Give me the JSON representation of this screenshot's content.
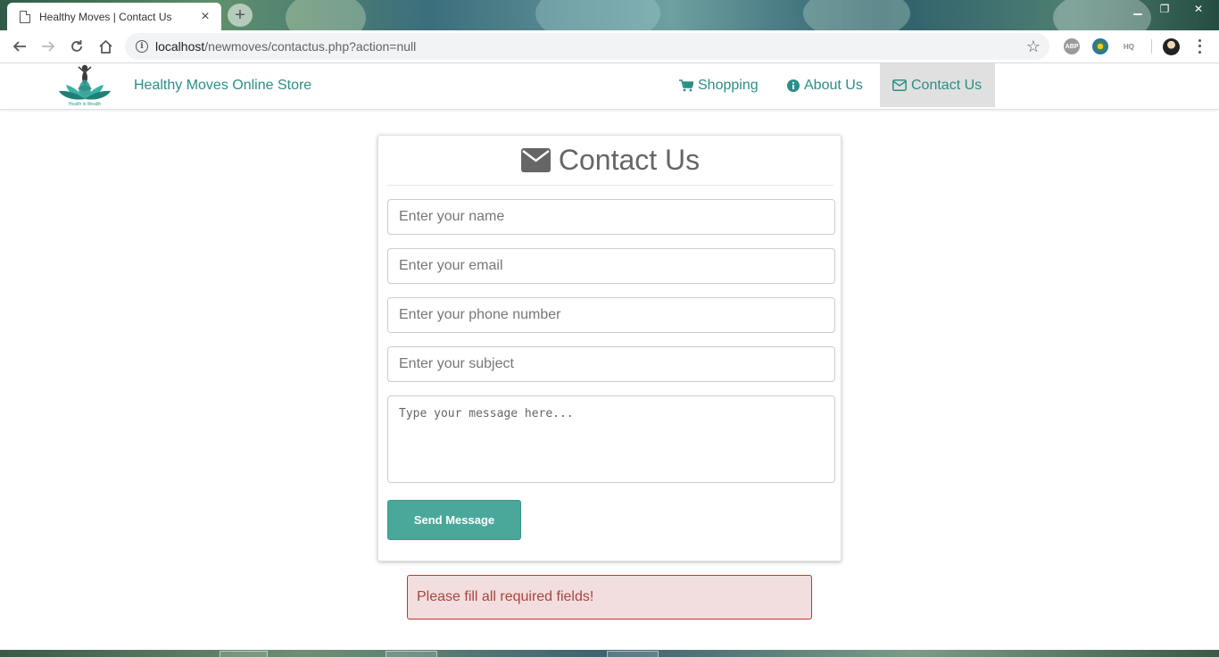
{
  "browser": {
    "tab_title": "Healthy Moves | Contact Us",
    "tab_close": "×",
    "new_tab": "+",
    "url_host": "localhost",
    "url_path": "/newmoves/contactus.php?action=null",
    "window_controls": {
      "minimize": "▁",
      "restore": "❐",
      "close": "✕"
    },
    "extensions": [
      {
        "name": "adblock-plus-icon",
        "text": "ABP",
        "color": "#888888"
      },
      {
        "name": "globe-extension-icon",
        "text": "",
        "color": "#3c8d3c"
      },
      {
        "name": "cloudhq-icon",
        "text": "HQ",
        "color": "#888888"
      }
    ]
  },
  "navbar": {
    "brand": "Healthy Moves Online Store",
    "logo_caption": "Health is Wealth",
    "items": [
      {
        "label": "Shopping",
        "icon": "shopping-cart-icon"
      },
      {
        "label": "About Us",
        "icon": "info-circle-icon"
      },
      {
        "label": "Contact Us",
        "icon": "envelope-icon",
        "active": true
      }
    ]
  },
  "form": {
    "title": "Contact Us",
    "name_placeholder": "Enter your name",
    "email_placeholder": "Enter your email",
    "phone_placeholder": "Enter your phone number",
    "subject_placeholder": "Enter your subject",
    "message_placeholder": "Type your message here...",
    "submit_label": "Send Message"
  },
  "alert": {
    "message": "Please fill all required fields!"
  },
  "colors": {
    "brand": "#2a8f86",
    "button": "#4aa89b",
    "alert_bg": "#f2dede",
    "alert_text": "#a94442"
  }
}
